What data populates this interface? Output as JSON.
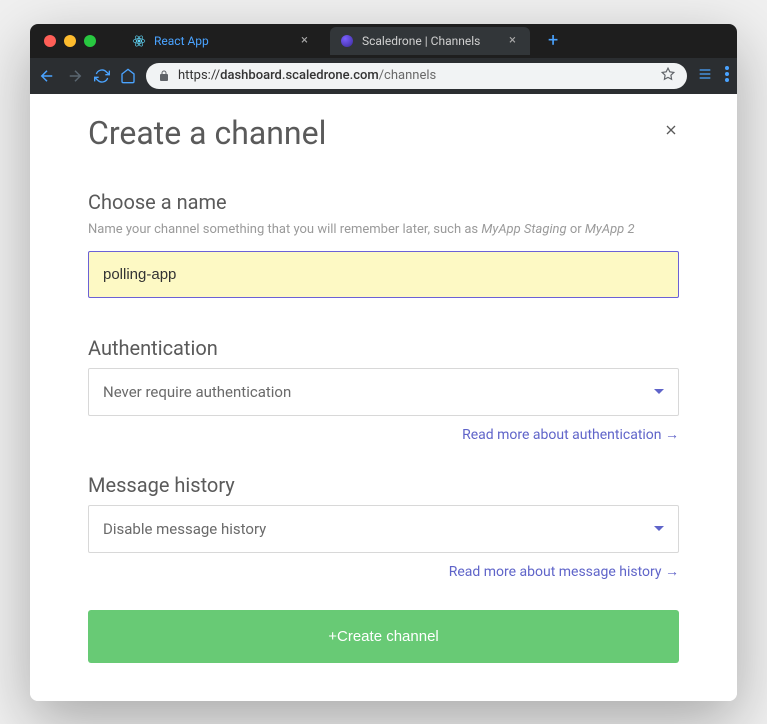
{
  "browser": {
    "tabs": [
      {
        "title": "React App",
        "active": false
      },
      {
        "title": "Scaledrone | Channels",
        "active": true
      }
    ],
    "url_scheme": "https://",
    "url_domain": "dashboard.scaledrone.com",
    "url_path": "/channels"
  },
  "dialog": {
    "title": "Create a channel",
    "name": {
      "heading": "Choose a name",
      "hint_prefix": "Name your channel something that you will remember later, such as ",
      "hint_example1": "MyApp Staging",
      "hint_or": " or ",
      "hint_example2": "MyApp 2",
      "value": "polling-app"
    },
    "authentication": {
      "heading": "Authentication",
      "selected": "Never require authentication",
      "read_more": "Read more about authentication →"
    },
    "message_history": {
      "heading": "Message history",
      "selected": "Disable message history",
      "read_more": "Read more about message history →"
    },
    "submit_label": "+Create channel"
  }
}
